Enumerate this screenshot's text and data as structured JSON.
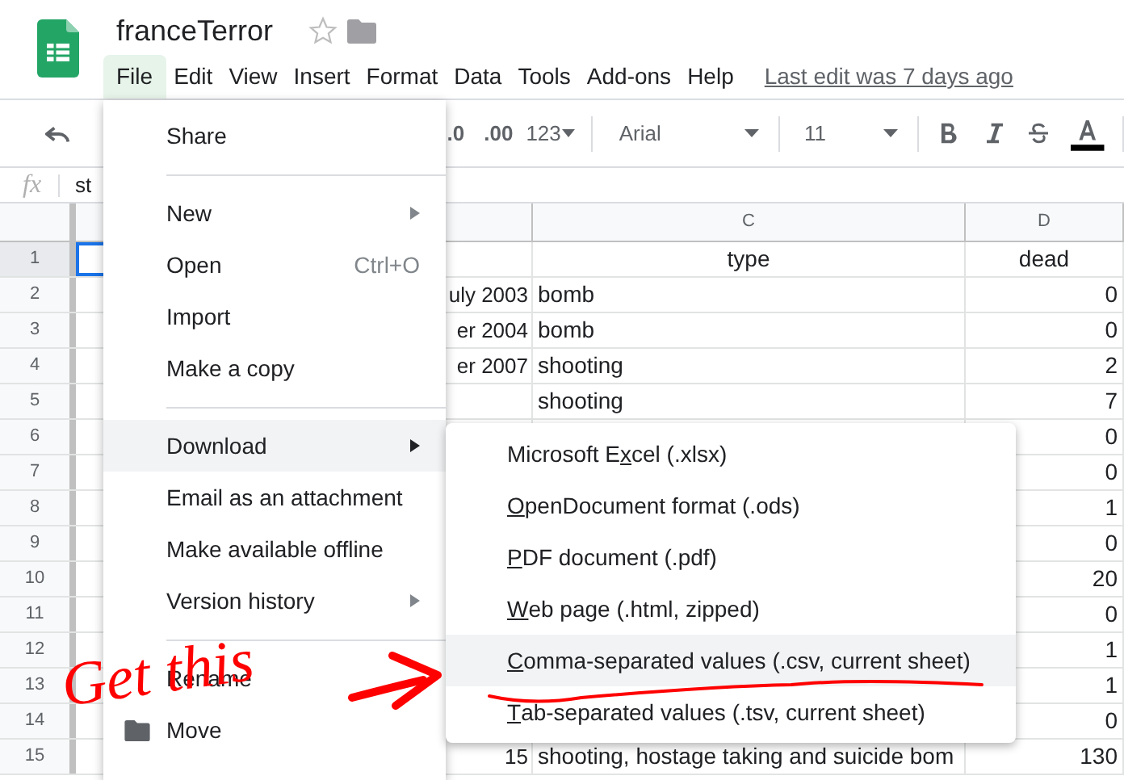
{
  "document": {
    "title": "franceTerror",
    "starred": false
  },
  "menu_bar": [
    {
      "label": "File",
      "selected": true
    },
    {
      "label": "Edit",
      "selected": false
    },
    {
      "label": "View",
      "selected": false
    },
    {
      "label": "Insert",
      "selected": false
    },
    {
      "label": "Format",
      "selected": false
    },
    {
      "label": "Data",
      "selected": false
    },
    {
      "label": "Tools",
      "selected": false
    },
    {
      "label": "Add-ons",
      "selected": false
    },
    {
      "label": "Help",
      "selected": false
    }
  ],
  "last_edit": "Last edit was 7 days ago",
  "toolbar": {
    "decimal_decrease": ".0",
    "decimal_increase": ".00",
    "number_format": "123",
    "font": "Arial",
    "font_size": "11"
  },
  "formula_bar": {
    "label": "fx",
    "value": "st"
  },
  "sheet": {
    "columns": [
      "",
      "",
      "C",
      "D"
    ],
    "rows": [
      {
        "number": "1",
        "selected": true,
        "cells": [
          "",
          "",
          "type",
          "dead"
        ]
      },
      {
        "number": "2",
        "selected": false,
        "cells": [
          "",
          "uly 2003",
          "bomb",
          "0"
        ]
      },
      {
        "number": "3",
        "selected": false,
        "cells": [
          "",
          "er 2004",
          "bomb",
          "0"
        ]
      },
      {
        "number": "4",
        "selected": false,
        "cells": [
          "",
          "er 2007",
          "shooting",
          "2"
        ]
      },
      {
        "number": "5",
        "selected": false,
        "cells": [
          "",
          "",
          "shooting",
          "7"
        ]
      },
      {
        "number": "6",
        "selected": false,
        "cells": [
          "",
          "",
          "",
          "0"
        ]
      },
      {
        "number": "7",
        "selected": false,
        "cells": [
          "",
          "",
          "",
          "0"
        ]
      },
      {
        "number": "8",
        "selected": false,
        "cells": [
          "",
          "",
          "",
          "1"
        ]
      },
      {
        "number": "9",
        "selected": false,
        "cells": [
          "",
          "",
          "",
          "0"
        ]
      },
      {
        "number": "10",
        "selected": false,
        "cells": [
          "",
          "",
          "",
          "20"
        ]
      },
      {
        "number": "11",
        "selected": false,
        "cells": [
          "",
          "",
          "",
          "0"
        ]
      },
      {
        "number": "12",
        "selected": false,
        "cells": [
          "",
          "",
          "",
          "1"
        ]
      },
      {
        "number": "13",
        "selected": false,
        "cells": [
          "",
          "",
          "",
          "1"
        ]
      },
      {
        "number": "14",
        "selected": false,
        "cells": [
          "",
          "",
          "",
          "0"
        ]
      },
      {
        "number": "15",
        "selected": false,
        "cells": [
          "",
          "15",
          "shooting, hostage taking and suicide bom",
          "130"
        ]
      }
    ]
  },
  "file_menu": [
    {
      "kind": "item",
      "label": "Share",
      "selected": false,
      "submenu": false
    },
    {
      "kind": "divider"
    },
    {
      "kind": "item",
      "label": "New",
      "selected": false,
      "submenu": true
    },
    {
      "kind": "item",
      "label": "Open",
      "shortcut": "Ctrl+O",
      "selected": false,
      "submenu": false
    },
    {
      "kind": "item",
      "label": "Import",
      "selected": false,
      "submenu": false
    },
    {
      "kind": "item",
      "label": "Make a copy",
      "selected": false,
      "submenu": false
    },
    {
      "kind": "divider"
    },
    {
      "kind": "item",
      "label": "Download",
      "selected": true,
      "submenu": true
    },
    {
      "kind": "item",
      "label": "Email as an attachment",
      "selected": false,
      "submenu": false
    },
    {
      "kind": "item",
      "label": "Make available offline",
      "selected": false,
      "submenu": false
    },
    {
      "kind": "item",
      "label": "Version history",
      "selected": false,
      "submenu": true
    },
    {
      "kind": "divider"
    },
    {
      "kind": "item",
      "label": "Rename",
      "selected": false,
      "submenu": false
    },
    {
      "kind": "folder_item",
      "label": "Move",
      "selected": false,
      "submenu": false
    }
  ],
  "download_menu": [
    {
      "before": "Microsoft E",
      "key": "x",
      "after": "cel (.xlsx)",
      "selected": false
    },
    {
      "key": "O",
      "after": "penDocument format (.ods)",
      "selected": false
    },
    {
      "key": "P",
      "after": "DF document (.pdf)",
      "selected": false
    },
    {
      "key": "W",
      "after": "eb page (.html, zipped)",
      "selected": false
    },
    {
      "key": "C",
      "after": "omma-separated values (.csv, current sheet)",
      "selected": true
    },
    {
      "key": "T",
      "after": "ab-separated values (.tsv, current sheet)",
      "selected": false
    }
  ],
  "annotation": {
    "text": "Get this"
  }
}
